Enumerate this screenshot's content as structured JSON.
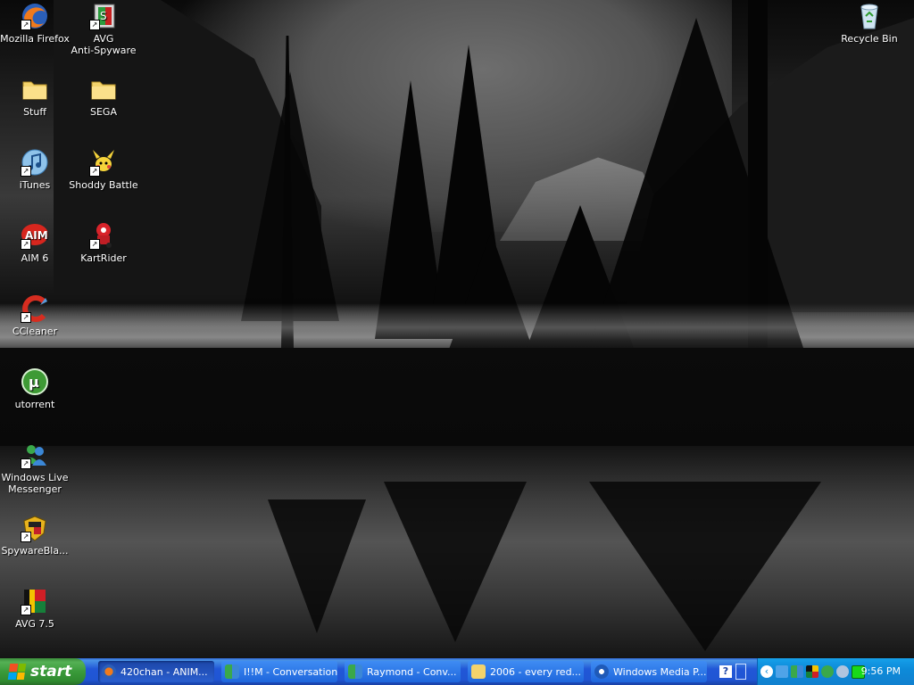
{
  "desktop": {
    "icons": [
      {
        "label": "Mozilla Firefox",
        "icon": "firefox-icon",
        "shortcut": true
      },
      {
        "label": "AVG\nAnti-Spyware",
        "icon": "avg-antispyware-icon",
        "shortcut": true
      },
      {
        "label": "Recycle Bin",
        "icon": "recycle-bin-icon",
        "shortcut": false
      },
      {
        "label": "Stuff",
        "icon": "folder-icon",
        "shortcut": false
      },
      {
        "label": "SEGA",
        "icon": "folder-icon",
        "shortcut": false
      },
      {
        "label": "iTunes",
        "icon": "itunes-icon",
        "shortcut": true
      },
      {
        "label": "Shoddy Battle",
        "icon": "shoddy-battle-icon",
        "shortcut": true
      },
      {
        "label": "AIM 6",
        "icon": "aim-icon",
        "shortcut": true
      },
      {
        "label": "KartRider",
        "icon": "kartrider-icon",
        "shortcut": true
      },
      {
        "label": "CCleaner",
        "icon": "ccleaner-icon",
        "shortcut": true
      },
      {
        "label": "utorrent",
        "icon": "utorrent-icon",
        "shortcut": false
      },
      {
        "label": "Windows Live Messenger",
        "icon": "messenger-icon",
        "shortcut": true
      },
      {
        "label": "SpywareBla...",
        "icon": "spywareblaster-icon",
        "shortcut": true
      },
      {
        "label": "AVG 7.5",
        "icon": "avg-icon",
        "shortcut": true
      }
    ]
  },
  "taskbar": {
    "start_label": "start",
    "tasks": [
      {
        "label": "420chan - ANIM...",
        "icon": "firefox-icon"
      },
      {
        "label": "I!!M - Conversation",
        "icon": "messenger-icon"
      },
      {
        "label": "Raymond - Conv...",
        "icon": "messenger-icon"
      },
      {
        "label": "2006 - every red...",
        "icon": "folder-icon"
      },
      {
        "label": "Windows Media P...",
        "icon": "media-player-icon"
      }
    ],
    "clock": "9:56 PM"
  },
  "colors": {
    "taskbar": "#2157d7",
    "start": "#3a9a3a",
    "tray": "#0d8bd9"
  }
}
